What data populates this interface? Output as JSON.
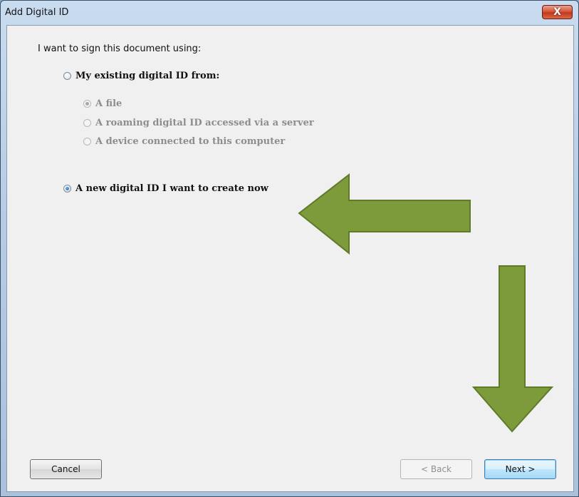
{
  "window": {
    "title": "Add Digital ID",
    "close_label": "X"
  },
  "prompt": "I want to sign this document using:",
  "options": {
    "existing": {
      "label": "My existing digital ID from:",
      "checked": false
    },
    "sub_file": {
      "label": "A file",
      "checked": true,
      "enabled": false
    },
    "sub_roaming": {
      "label": "A roaming digital ID accessed via a server",
      "checked": false,
      "enabled": false
    },
    "sub_device": {
      "label": "A device connected to this computer",
      "checked": false,
      "enabled": false
    },
    "create_new": {
      "label": "A new digital ID I want to create now",
      "checked": true
    }
  },
  "buttons": {
    "cancel": "Cancel",
    "back": "< Back",
    "next": "Next >"
  },
  "annotations": {
    "arrow_color": "#7e9b3b",
    "arrow_border": "#5f7a28"
  }
}
